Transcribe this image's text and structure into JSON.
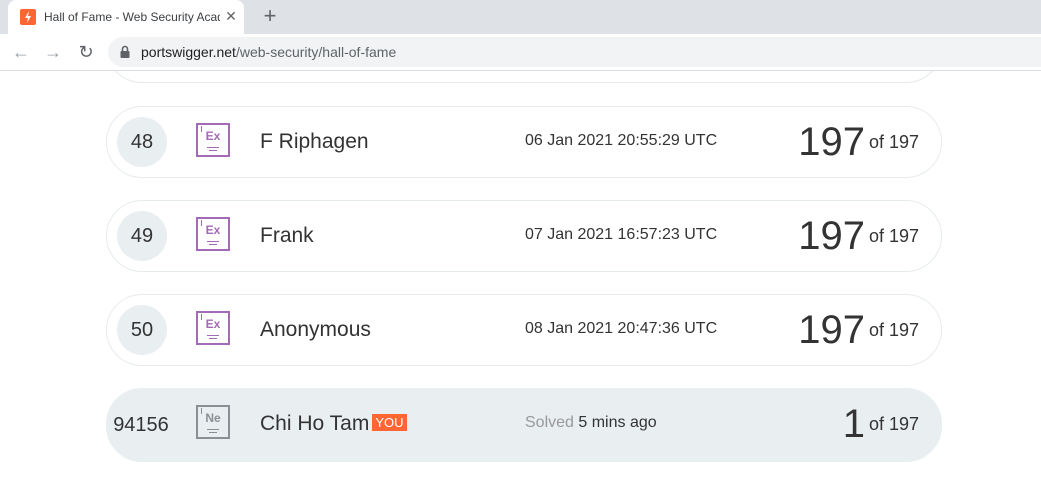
{
  "browser": {
    "tab_title": "Hall of Fame - Web Security Academy",
    "tab_close": "✕",
    "new_tab": "+",
    "url_host": "portswigger.net",
    "url_path": "/web-security/hall-of-fame",
    "back_icon": "←",
    "forward_icon": "→",
    "reload_icon": "↻"
  },
  "rows": [
    {
      "rank": "48",
      "badge": "Ex",
      "name": "F Riphagen",
      "time": "06 Jan 2021 20:55:29 UTC",
      "solved": "197",
      "of": "of 197"
    },
    {
      "rank": "49",
      "badge": "Ex",
      "name": "Frank",
      "time": "07 Jan 2021 16:57:23 UTC",
      "solved": "197",
      "of": "of 197"
    },
    {
      "rank": "50",
      "badge": "Ex",
      "name": "Anonymous",
      "time": "08 Jan 2021 20:47:36 UTC",
      "solved": "197",
      "of": "of 197"
    }
  ],
  "me": {
    "rank": "94156",
    "badge": "Ne",
    "name": "Chi Ho Tam",
    "you_label": "YOU",
    "solved_prefix": "Solved",
    "time": "5 mins ago",
    "solved": "1",
    "of": "of 197"
  },
  "colors": {
    "accent": "#ff6633",
    "expert_badge": "#a36bb5",
    "novice_badge": "#8a8f93",
    "row_highlight": "#e9eef1"
  }
}
